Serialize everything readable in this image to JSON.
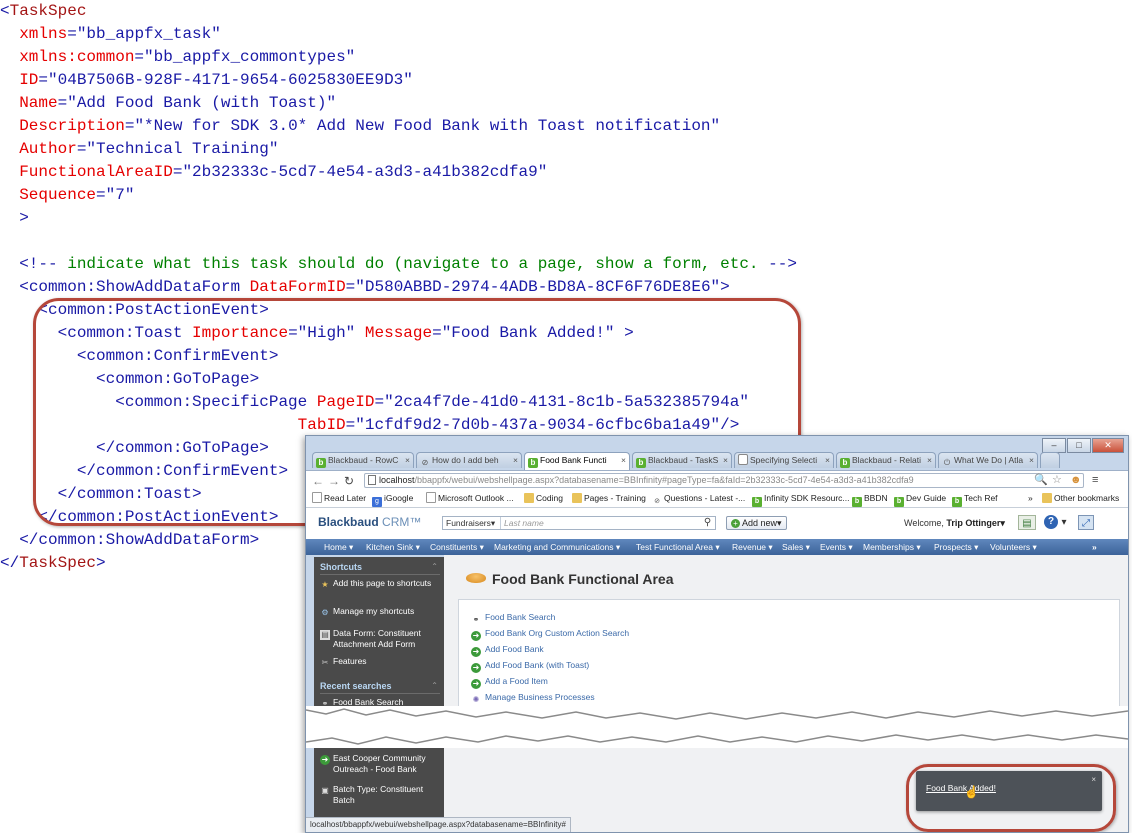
{
  "code": {
    "lines": [
      {
        "parts": [
          {
            "c": "lt",
            "t": "<"
          },
          {
            "c": "tg",
            "t": "TaskSpec"
          }
        ]
      },
      {
        "parts": [
          {
            "c": "at",
            "t": "  xmlns"
          },
          {
            "c": "lt",
            "t": "="
          },
          {
            "c": "av",
            "t": "\"bb_appfx_task\""
          }
        ]
      },
      {
        "parts": [
          {
            "c": "at",
            "t": "  xmlns:common"
          },
          {
            "c": "lt",
            "t": "="
          },
          {
            "c": "av",
            "t": "\"bb_appfx_commontypes\""
          }
        ]
      },
      {
        "parts": [
          {
            "c": "at",
            "t": "  ID"
          },
          {
            "c": "lt",
            "t": "="
          },
          {
            "c": "av",
            "t": "\"04B7506B-928F-4171-9654-6025830EE9D3\""
          }
        ]
      },
      {
        "parts": [
          {
            "c": "at",
            "t": "  Name"
          },
          {
            "c": "lt",
            "t": "="
          },
          {
            "c": "av",
            "t": "\"Add Food Bank (with Toast)\""
          }
        ]
      },
      {
        "parts": [
          {
            "c": "at",
            "t": "  Description"
          },
          {
            "c": "lt",
            "t": "="
          },
          {
            "c": "av",
            "t": "\"*New for SDK 3.0* Add New Food Bank with Toast notification\""
          }
        ]
      },
      {
        "parts": [
          {
            "c": "at",
            "t": "  Author"
          },
          {
            "c": "lt",
            "t": "="
          },
          {
            "c": "av",
            "t": "\"Technical Training\""
          }
        ]
      },
      {
        "parts": [
          {
            "c": "at",
            "t": "  FunctionalAreaID"
          },
          {
            "c": "lt",
            "t": "="
          },
          {
            "c": "av",
            "t": "\"2b32333c-5cd7-4e54-a3d3-a41b382cdfa9\""
          }
        ]
      },
      {
        "parts": [
          {
            "c": "at",
            "t": "  Sequence"
          },
          {
            "c": "lt",
            "t": "="
          },
          {
            "c": "av",
            "t": "\"7\""
          }
        ]
      },
      {
        "parts": [
          {
            "c": "lt",
            "t": "  >"
          }
        ]
      },
      {
        "parts": []
      },
      {
        "parts": [
          {
            "c": "lt",
            "t": "  <!--"
          },
          {
            "c": "cm",
            "t": " indicate what this task should do (navigate to a page, show a form, etc. "
          },
          {
            "c": "lt",
            "t": "-->"
          }
        ]
      },
      {
        "parts": [
          {
            "c": "lt",
            "t": "  <"
          },
          {
            "c": "tgb",
            "t": "common:ShowAddDataForm"
          },
          {
            "c": "at",
            "t": " DataFormID"
          },
          {
            "c": "lt",
            "t": "="
          },
          {
            "c": "av",
            "t": "\"D580ABBD-2974-4ADB-BD8A-8CF6F76DE8E6\""
          },
          {
            "c": "lt",
            "t": ">"
          }
        ]
      },
      {
        "parts": [
          {
            "c": "lt",
            "t": "    <"
          },
          {
            "c": "tgb",
            "t": "common:PostActionEvent"
          },
          {
            "c": "lt",
            "t": ">"
          }
        ]
      },
      {
        "parts": [
          {
            "c": "lt",
            "t": "      <"
          },
          {
            "c": "tgb",
            "t": "common:Toast"
          },
          {
            "c": "at",
            "t": " Importance"
          },
          {
            "c": "lt",
            "t": "="
          },
          {
            "c": "av",
            "t": "\"High\""
          },
          {
            "c": "at",
            "t": " Message"
          },
          {
            "c": "lt",
            "t": "="
          },
          {
            "c": "av",
            "t": "\"Food Bank Added!\""
          },
          {
            "c": "lt",
            "t": " >"
          }
        ]
      },
      {
        "parts": [
          {
            "c": "lt",
            "t": "        <"
          },
          {
            "c": "tgb",
            "t": "common:ConfirmEvent"
          },
          {
            "c": "lt",
            "t": ">"
          }
        ]
      },
      {
        "parts": [
          {
            "c": "lt",
            "t": "          <"
          },
          {
            "c": "tgb",
            "t": "common:GoToPage"
          },
          {
            "c": "lt",
            "t": ">"
          }
        ]
      },
      {
        "parts": [
          {
            "c": "lt",
            "t": "            <"
          },
          {
            "c": "tgb",
            "t": "common:SpecificPage"
          },
          {
            "c": "at",
            "t": " PageID"
          },
          {
            "c": "lt",
            "t": "="
          },
          {
            "c": "av",
            "t": "\"2ca4f7de-41d0-4131-8c1b-5a532385794a\""
          }
        ]
      },
      {
        "parts": [
          {
            "c": "at",
            "t": "                               TabID"
          },
          {
            "c": "lt",
            "t": "="
          },
          {
            "c": "av",
            "t": "\"1cfdf9d2-7d0b-437a-9034-6cfbc6ba1a49\""
          },
          {
            "c": "lt",
            "t": "/>"
          }
        ]
      },
      {
        "parts": [
          {
            "c": "lt",
            "t": "          </"
          },
          {
            "c": "tgb",
            "t": "common:GoToPage"
          },
          {
            "c": "lt",
            "t": ">"
          }
        ]
      },
      {
        "parts": [
          {
            "c": "lt",
            "t": "        </"
          },
          {
            "c": "tgb",
            "t": "common:ConfirmEvent"
          },
          {
            "c": "lt",
            "t": ">"
          }
        ]
      },
      {
        "parts": [
          {
            "c": "lt",
            "t": "      </"
          },
          {
            "c": "tgb",
            "t": "common:Toast"
          },
          {
            "c": "lt",
            "t": ">"
          }
        ]
      },
      {
        "parts": [
          {
            "c": "lt",
            "t": "    </"
          },
          {
            "c": "tgb",
            "t": "common:PostActionEvent"
          },
          {
            "c": "lt",
            "t": ">"
          }
        ]
      },
      {
        "parts": [
          {
            "c": "lt",
            "t": "  </"
          },
          {
            "c": "tgb",
            "t": "common:ShowAddDataForm"
          },
          {
            "c": "lt",
            "t": ">"
          }
        ]
      },
      {
        "parts": [
          {
            "c": "lt",
            "t": "</"
          },
          {
            "c": "tg",
            "t": "TaskSpec"
          },
          {
            "c": "lt",
            "t": ">"
          }
        ]
      }
    ]
  },
  "browser": {
    "tabs": [
      {
        "icon": "blackbaud-icon",
        "label": "Blackbaud - RowC",
        "active": false
      },
      {
        "icon": "no-entry-icon",
        "label": "How do I add beh",
        "active": false
      },
      {
        "icon": "blackbaud-icon",
        "label": "Food Bank Functi",
        "active": true
      },
      {
        "icon": "blackbaud-icon",
        "label": "Blackbaud - TaskS",
        "active": false
      },
      {
        "icon": "page-icon",
        "label": "Specifying Selecti",
        "active": false
      },
      {
        "icon": "blackbaud-icon",
        "label": "Blackbaud - Relati",
        "active": false
      },
      {
        "icon": "power-icon",
        "label": "What We Do | Atla",
        "active": false
      }
    ],
    "url_host": "localhost",
    "url_path": "/bbappfx/webui/webshellpage.aspx?databasename=BBInfinity#pageType=fa&faId=2b32333c-5cd7-4e54-a3d3-a41b382cdfa9",
    "bookmarks": [
      "Read Later",
      "iGoogle",
      "Microsoft Outlook ...",
      "Coding",
      "Pages - Training",
      "Questions - Latest -...",
      "Infinity SDK Resourc...",
      "BBDN",
      "Dev Guide",
      "Tech Ref"
    ],
    "bookmarks_more": "»",
    "other_bookmarks": "Other bookmarks",
    "status_url": "localhost/bbappfx/webui/webshellpage.aspx?databasename=BBInfinity#"
  },
  "crm": {
    "logo_main": "Blackbaud",
    "logo_sub": "CRM™",
    "search_category": "Fundraisers▾",
    "search_placeholder": "Last name",
    "add_new_label": "Add new▾",
    "welcome_prefix": "Welcome,",
    "user_name": "Trip Ottinger▾",
    "nav": [
      "Home ▾",
      "Kitchen Sink ▾",
      "Constituents ▾",
      "Marketing and Communications ▾",
      "Test Functional Area ▾",
      "Revenue ▾",
      "Sales ▾",
      "Events ▾",
      "Memberships ▾",
      "Prospects ▾",
      "Volunteers ▾"
    ],
    "nav_more": "»",
    "sidebar": {
      "shortcuts_title": "Shortcuts",
      "shortcuts": [
        "Add this page to shortcuts",
        "Manage my shortcuts",
        "Data Form: Constituent Attachment Add Form",
        "Features"
      ],
      "recent_title": "Recent searches",
      "recent": [
        "Food Bank Search"
      ],
      "lower": [
        "East Cooper Community Outreach - Food Bank",
        "Batch Type: Constituent Batch"
      ]
    },
    "page_title": "Food Bank Functional Area",
    "actions": [
      {
        "icon": "binoculars-icon",
        "label": "Food Bank Search"
      },
      {
        "icon": "go-arrow-icon",
        "label": "Food Bank Org Custom Action Search"
      },
      {
        "icon": "go-arrow-icon",
        "label": "Add Food Bank"
      },
      {
        "icon": "go-arrow-icon",
        "label": "Add Food Bank (with Toast)"
      },
      {
        "icon": "go-arrow-icon",
        "label": "Add a Food Item"
      },
      {
        "icon": "gear-icon",
        "label": "Manage Business Processes"
      }
    ],
    "toast_message": "Food Bank Added!",
    "toast_close": "×"
  },
  "colors": {
    "callout": "#b5473a",
    "nav_blue": "#4a74ad",
    "sidebar_dark": "#4a4a4a",
    "toast": "#4d5258"
  }
}
